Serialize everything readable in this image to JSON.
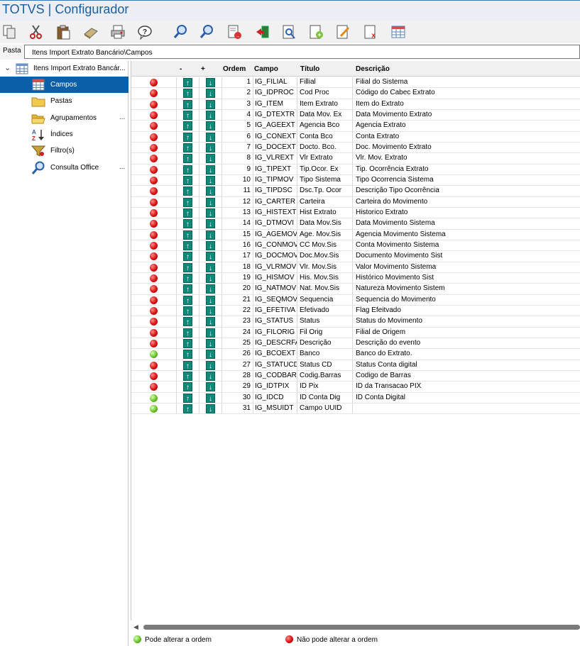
{
  "app": {
    "title": "TOTVS | Configurador"
  },
  "toolbar": {
    "buttons": [
      {
        "name": "copy-icon"
      },
      {
        "name": "cut-icon"
      },
      {
        "name": "paste-icon"
      },
      {
        "name": "eraser-icon"
      },
      {
        "name": "print-icon"
      },
      {
        "name": "help-icon"
      },
      {
        "name": "search-icon"
      },
      {
        "name": "search-next-icon"
      },
      {
        "name": "export-icon"
      },
      {
        "name": "exit-icon"
      },
      {
        "name": "preview-icon"
      },
      {
        "name": "new-icon"
      },
      {
        "name": "edit-icon"
      },
      {
        "name": "delete-icon"
      },
      {
        "name": "table-icon"
      }
    ]
  },
  "path": {
    "label": "Pasta",
    "value": "Itens Import Extrato Bancário\\Campos"
  },
  "tree": {
    "root": "Itens Import Extrato Bancár...",
    "items": [
      {
        "label": "Campos",
        "icon": "table-icon",
        "selected": true,
        "dots": ""
      },
      {
        "label": "Pastas",
        "icon": "folder-icon",
        "selected": false,
        "dots": ""
      },
      {
        "label": "Agrupamentos",
        "icon": "folder-open-icon",
        "selected": false,
        "dots": "..."
      },
      {
        "label": "Índices",
        "icon": "sort-az-icon",
        "selected": false,
        "dots": ""
      },
      {
        "label": "Filtro(s)",
        "icon": "filter-icon",
        "selected": false,
        "dots": ""
      },
      {
        "label": "Consulta Office",
        "icon": "magnifier-icon",
        "selected": false,
        "dots": "..."
      }
    ]
  },
  "grid": {
    "headers": {
      "minus": "-",
      "plus": "+",
      "ordem": "Ordem",
      "campo": "Campo",
      "titulo": "Título",
      "descricao": "Descrição"
    },
    "rows": [
      {
        "status": "red",
        "ordem": "1",
        "campo": "IG_FILIAL",
        "titulo": "Fillial",
        "descricao": "Filial do Sistema"
      },
      {
        "status": "red",
        "ordem": "2",
        "campo": "IG_IDPROC",
        "titulo": "Cod Proc",
        "descricao": "Código do Cabec Extrato"
      },
      {
        "status": "red",
        "ordem": "3",
        "campo": "IG_ITEM",
        "titulo": "Item Extrato",
        "descricao": "Item do Extrato"
      },
      {
        "status": "red",
        "ordem": "4",
        "campo": "IG_DTEXTR",
        "titulo": "Data Mov. Ex",
        "descricao": "Data Movimento Extrato"
      },
      {
        "status": "red",
        "ordem": "5",
        "campo": "IG_AGEEXT",
        "titulo": "Agencia Bco",
        "descricao": "Agencia Extrato"
      },
      {
        "status": "red",
        "ordem": "6",
        "campo": "IG_CONEXT",
        "titulo": "Conta Bco",
        "descricao": "Conta Extrato"
      },
      {
        "status": "red",
        "ordem": "7",
        "campo": "IG_DOCEXT",
        "titulo": "Docto. Bco.",
        "descricao": "Doc. Movimento Extrato"
      },
      {
        "status": "red",
        "ordem": "8",
        "campo": "IG_VLREXT",
        "titulo": "Vlr Extrato",
        "descricao": "Vlr. Mov. Extrato"
      },
      {
        "status": "red",
        "ordem": "9",
        "campo": "IG_TIPEXT",
        "titulo": "Tip.Ocor. Ex",
        "descricao": "Tip. Ocorrência Extrato"
      },
      {
        "status": "red",
        "ordem": "10",
        "campo": "IG_TIPMOV",
        "titulo": "Tipo Sistema",
        "descricao": "Tipo Ocorrencia Sistema"
      },
      {
        "status": "red",
        "ordem": "11",
        "campo": "IG_TIPDSC",
        "titulo": "Dsc.Tp. Ocor",
        "descricao": "Descrição Tipo Ocorrência"
      },
      {
        "status": "red",
        "ordem": "12",
        "campo": "IG_CARTER",
        "titulo": "Carteira",
        "descricao": "Carteira do Movimento"
      },
      {
        "status": "red",
        "ordem": "13",
        "campo": "IG_HISTEXT",
        "titulo": "Hist Extrato",
        "descricao": "Historico Extrato"
      },
      {
        "status": "red",
        "ordem": "14",
        "campo": "IG_DTMOVI",
        "titulo": "Data Mov.Sis",
        "descricao": "Data Movimento Sistema"
      },
      {
        "status": "red",
        "ordem": "15",
        "campo": "IG_AGEMOV",
        "titulo": "Age. Mov.Sis",
        "descricao": "Agencia Movimento Sistema"
      },
      {
        "status": "red",
        "ordem": "16",
        "campo": "IG_CONMOV",
        "titulo": "CC Mov.Sis",
        "descricao": "Conta Movimento Sistema"
      },
      {
        "status": "red",
        "ordem": "17",
        "campo": "IG_DOCMOV",
        "titulo": "Doc.Mov.Sis",
        "descricao": "Documento Movimento Sist"
      },
      {
        "status": "red",
        "ordem": "18",
        "campo": "IG_VLRMOV",
        "titulo": "Vlr. Mov.Sis",
        "descricao": "Valor Movimento Sistema"
      },
      {
        "status": "red",
        "ordem": "19",
        "campo": "IG_HISMOV",
        "titulo": "His. Mov.Sis",
        "descricao": "Histórico Movimento Sist"
      },
      {
        "status": "red",
        "ordem": "20",
        "campo": "IG_NATMOV",
        "titulo": "Nat. Mov.Sis",
        "descricao": "Natureza Movimento Sistem"
      },
      {
        "status": "red",
        "ordem": "21",
        "campo": "IG_SEQMOV",
        "titulo": "Sequencia",
        "descricao": "Sequencia do Movimento"
      },
      {
        "status": "red",
        "ordem": "22",
        "campo": "IG_EFETIVA",
        "titulo": "Efetivado",
        "descricao": "Flag Efeitvado"
      },
      {
        "status": "red",
        "ordem": "23",
        "campo": "IG_STATUS",
        "titulo": "Status",
        "descricao": "Status do Movimento"
      },
      {
        "status": "red",
        "ordem": "24",
        "campo": "IG_FILORIG",
        "titulo": "Fil Orig",
        "descricao": "Filial de Origem"
      },
      {
        "status": "red",
        "ordem": "25",
        "campo": "IG_DESCRFA",
        "titulo": "Descrição",
        "descricao": "Descrição do evento"
      },
      {
        "status": "green",
        "ordem": "26",
        "campo": "IG_BCOEXT",
        "titulo": "Banco",
        "descricao": "Banco do Extrato."
      },
      {
        "status": "red",
        "ordem": "27",
        "campo": "IG_STATUCD",
        "titulo": "Status CD",
        "descricao": "Status Conta digital"
      },
      {
        "status": "red",
        "ordem": "28",
        "campo": "IG_CODBAR",
        "titulo": "Codig.Barras",
        "descricao": "Codigo de Barras"
      },
      {
        "status": "red",
        "ordem": "29",
        "campo": "IG_IDTPIX",
        "titulo": "ID Pix",
        "descricao": "ID da Transacao PIX"
      },
      {
        "status": "green",
        "ordem": "30",
        "campo": "IG_IDCD",
        "titulo": "ID Conta Dig",
        "descricao": "ID Conta Digital"
      },
      {
        "status": "green",
        "ordem": "31",
        "campo": "IG_MSUIDT",
        "titulo": "Campo UUID",
        "descricao": ""
      }
    ]
  },
  "legend": {
    "green_label": "Pode alterar a ordem",
    "red_label": "Não pode alterar a ordem"
  },
  "colors": {
    "accent": "#0a5fa8",
    "title": "#1b5e9e",
    "arrow": "#0f8a7a"
  }
}
